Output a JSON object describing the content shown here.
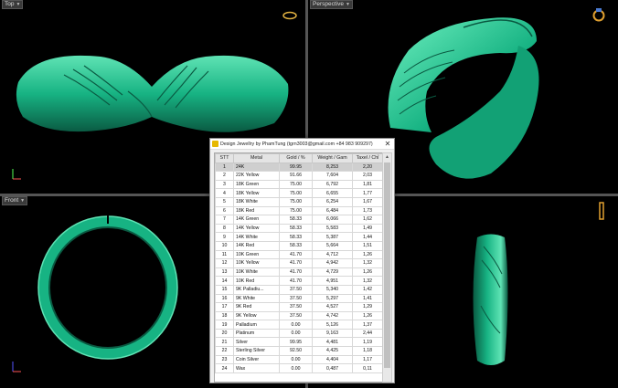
{
  "viewports": {
    "top": {
      "label": "Top"
    },
    "perspective": {
      "label": "Perspective"
    },
    "front": {
      "label": "Front"
    },
    "right": {
      "label": ""
    }
  },
  "axis": {
    "x": "x",
    "y": "y",
    "z": "z"
  },
  "dialog": {
    "title": "Design Jewellry by PhamTung (tgrn3003@gmail.com +84 983 909297)",
    "close": "✕",
    "columns": [
      "STT",
      "Metal",
      "Gold / %",
      "Weight / Gam",
      "Taxel / Chỉ"
    ],
    "rows": [
      [
        "1",
        "24K",
        "99.95",
        "8,253",
        "2,20"
      ],
      [
        "2",
        "22K Yellow",
        "91.66",
        "7,604",
        "2,03"
      ],
      [
        "3",
        "18K Green",
        "75.00",
        "6,792",
        "1,81"
      ],
      [
        "4",
        "18K Yellow",
        "75.00",
        "6,655",
        "1,77"
      ],
      [
        "5",
        "18K White",
        "75.00",
        "6,254",
        "1,67"
      ],
      [
        "6",
        "18K Red",
        "75.00",
        "6,484",
        "1,73"
      ],
      [
        "7",
        "14K Green",
        "58.33",
        "6,066",
        "1,62"
      ],
      [
        "8",
        "14K Yellow",
        "58.33",
        "5,583",
        "1,49"
      ],
      [
        "9",
        "14K White",
        "58.33",
        "5,387",
        "1,44"
      ],
      [
        "10",
        "14K Red",
        "58.33",
        "5,664",
        "1,51"
      ],
      [
        "11",
        "10K Green",
        "41.70",
        "4,712",
        "1,26"
      ],
      [
        "12",
        "10K Yellow",
        "41.70",
        "4,942",
        "1,32"
      ],
      [
        "13",
        "10K White",
        "41.70",
        "4,729",
        "1,26"
      ],
      [
        "14",
        "10K Red",
        "41.70",
        "4,951",
        "1,32"
      ],
      [
        "15",
        "9K Palladiu...",
        "37.50",
        "5,340",
        "1,42"
      ],
      [
        "16",
        "9K White",
        "37.50",
        "5,297",
        "1,41"
      ],
      [
        "17",
        "9K Red",
        "37.50",
        "4,527",
        "1,29"
      ],
      [
        "18",
        "9K Yellow",
        "37.50",
        "4,742",
        "1,26"
      ],
      [
        "19",
        "Palladium",
        "0.00",
        "5,126",
        "1,37"
      ],
      [
        "20",
        "Platinum",
        "0.00",
        "9,163",
        "2,44"
      ],
      [
        "21",
        "Silver",
        "99.95",
        "4,481",
        "1,19"
      ],
      [
        "22",
        "Sterling Silver",
        "92.50",
        "4,425",
        "1,18"
      ],
      [
        "23",
        "Coin Silver",
        "0.00",
        "4,404",
        "1,17"
      ],
      [
        "24",
        "Wax",
        "0.00",
        "0,487",
        "0,11"
      ]
    ]
  },
  "colors": {
    "ring": "#17b383",
    "ring_dark": "#0a6048",
    "ring_light": "#5fe3b4",
    "background": "#000000"
  }
}
